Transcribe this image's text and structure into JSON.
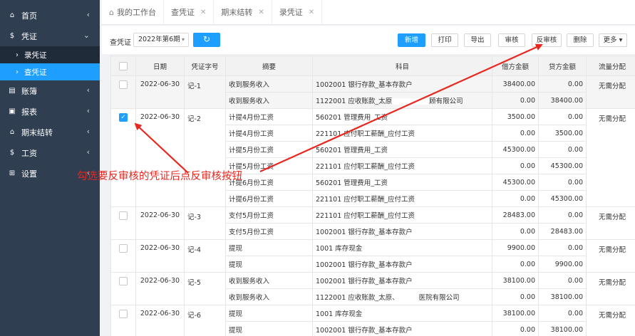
{
  "sidebar": {
    "items": [
      {
        "icon": "home-icon",
        "label": "首页"
      },
      {
        "icon": "dollar-icon",
        "label": "凭证"
      },
      {
        "icon": "ledger-icon",
        "label": "账簿"
      },
      {
        "icon": "report-icon",
        "label": "报表"
      },
      {
        "icon": "period-close-icon",
        "label": "期末结转"
      },
      {
        "icon": "salary-icon",
        "label": "工资"
      },
      {
        "icon": "settings-grid-icon",
        "label": "设置"
      }
    ],
    "sub_items": [
      {
        "label": "录凭证"
      },
      {
        "label": "查凭证"
      }
    ]
  },
  "tabs": [
    {
      "label": "我的工作台"
    },
    {
      "label": "查凭证"
    },
    {
      "label": "期末结转"
    },
    {
      "label": "录凭证"
    }
  ],
  "toolbar": {
    "label": "查凭证",
    "period_value": "2022年第6期",
    "buttons": {
      "new": "新增",
      "print": "打印",
      "export": "导出",
      "audit": "审核",
      "unaudit": "反审核",
      "delete": "删除",
      "more": "更多"
    }
  },
  "table": {
    "headers": [
      "日期",
      "凭证字号",
      "摘要",
      "科目",
      "借方金额",
      "贷方金额",
      "流量分配"
    ],
    "vouchers": [
      {
        "date": "2022-06-30",
        "no": "记-1",
        "flow": "无需分配",
        "checked": false,
        "lines": [
          {
            "summary": "收到服务收入",
            "account": "1002001 银行存款_基本存款户",
            "debit": "38400.00",
            "credit": "0.00"
          },
          {
            "summary": "收到服务收入",
            "account_a": "1122001 应收账款_太原",
            "account_b": "顾有限公司",
            "debit": "0.00",
            "credit": "38400.00"
          }
        ]
      },
      {
        "date": "2022-06-30",
        "no": "记-2",
        "flow": "无需分配",
        "checked": true,
        "lines": [
          {
            "summary": "计提4月份工资",
            "account": "560201 管理费用_工资",
            "debit": "3500.00",
            "credit": "0.00"
          },
          {
            "summary": "计提4月份工资",
            "account": "221101 应付职工薪酬_应付工资",
            "debit": "0.00",
            "credit": "3500.00"
          },
          {
            "summary": "计提5月份工资",
            "account": "560201 管理费用_工资",
            "debit": "45300.00",
            "credit": "0.00"
          },
          {
            "summary": "计提5月份工资",
            "account": "221101 应付职工薪酬_应付工资",
            "debit": "0.00",
            "credit": "45300.00"
          },
          {
            "summary": "计提6月份工资",
            "account": "560201 管理费用_工资",
            "debit": "45300.00",
            "credit": "0.00"
          },
          {
            "summary": "计提6月份工资",
            "account": "221101 应付职工薪酬_应付工资",
            "debit": "0.00",
            "credit": "45300.00"
          }
        ]
      },
      {
        "date": "2022-06-30",
        "no": "记-3",
        "flow": "无需分配",
        "checked": false,
        "lines": [
          {
            "summary": "支付5月份工资",
            "account": "221101 应付职工薪酬_应付工资",
            "debit": "28483.00",
            "credit": "0.00"
          },
          {
            "summary": "支付5月份工资",
            "account": "1002001 银行存款_基本存款户",
            "debit": "0.00",
            "credit": "28483.00"
          }
        ]
      },
      {
        "date": "2022-06-30",
        "no": "记-4",
        "flow": "无需分配",
        "checked": false,
        "lines": [
          {
            "summary": "提现",
            "account": "1001 库存现金",
            "debit": "9900.00",
            "credit": "0.00"
          },
          {
            "summary": "提现",
            "account": "1002001 银行存款_基本存款户",
            "debit": "0.00",
            "credit": "9900.00"
          }
        ]
      },
      {
        "date": "2022-06-30",
        "no": "记-5",
        "flow": "无需分配",
        "checked": false,
        "lines": [
          {
            "summary": "收到服务收入",
            "account": "1002001 银行存款_基本存款户",
            "debit": "38100.00",
            "credit": "0.00"
          },
          {
            "summary": "收到服务收入",
            "account_a": "1122001 应收账款_太原、",
            "account_b": "医院有限公司",
            "debit": "0.00",
            "credit": "38100.00"
          }
        ]
      },
      {
        "date": "2022-06-30",
        "no": "记-6",
        "flow": "无需分配",
        "checked": false,
        "lines": [
          {
            "summary": "提现",
            "account": "1001 库存现金",
            "debit": "38100.00",
            "credit": "0.00"
          },
          {
            "summary": "提现",
            "account": "1002001 银行存款_基本存款户",
            "debit": "0.00",
            "credit": "38100.00"
          }
        ]
      }
    ]
  },
  "annotation": {
    "text": "勾选要反审核的凭证后点反审核按钮",
    "color": "#e8271f"
  },
  "colors": {
    "sidebar_bg": "#2f3e51",
    "accent": "#1e9fff"
  }
}
